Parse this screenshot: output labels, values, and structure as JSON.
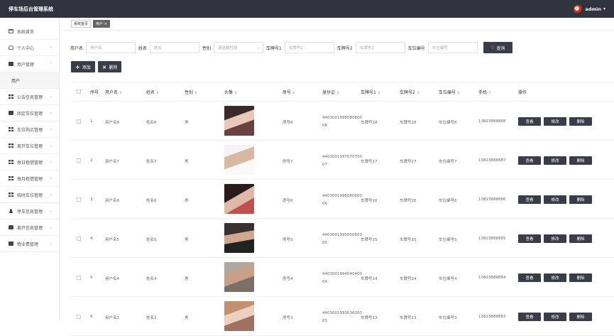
{
  "app": {
    "title": "停车场后台管理系统",
    "username": "admin"
  },
  "sidebar": {
    "items": [
      {
        "label": "系统首页",
        "icon": "home-icon",
        "chevron": ""
      },
      {
        "label": "个人中心",
        "icon": "user-icon",
        "chevron": "⌄"
      },
      {
        "label": "用户管理",
        "icon": "monitor-icon",
        "chevron": "⌃"
      },
      {
        "label": "公告信息管理",
        "icon": "grid-icon",
        "chevron": "⌄"
      },
      {
        "label": "固定车位管理",
        "icon": "message-icon",
        "chevron": "⌄"
      },
      {
        "label": "车位购买管理",
        "icon": "grid-icon",
        "chevron": "⌄"
      },
      {
        "label": "离开车位管理",
        "icon": "grid-icon",
        "chevron": "⌄"
      },
      {
        "label": "每日租借管理",
        "icon": "grid-icon",
        "chevron": "⌄"
      },
      {
        "label": "每月租借管理",
        "icon": "grid-icon",
        "chevron": "⌄"
      },
      {
        "label": "临时车位管理",
        "icon": "grid-icon",
        "chevron": "⌄"
      },
      {
        "label": "停车信息管理",
        "icon": "person-icon",
        "chevron": "⌄"
      },
      {
        "label": "离开信息管理",
        "icon": "car-icon",
        "chevron": "⌄"
      },
      {
        "label": "物业费管理",
        "icon": "trash-icon",
        "chevron": "⌄"
      }
    ],
    "sub_item": "用户"
  },
  "tabs": [
    {
      "label": "系统首页"
    },
    {
      "label": "用户 ×"
    }
  ],
  "search": {
    "username_label": "用户名",
    "username_placeholder": "用户名",
    "name_label": "姓名",
    "name_placeholder": "姓名",
    "gender_label": "性别",
    "gender_placeholder": "请选择性别",
    "plate1_label": "车牌号1",
    "plate1_placeholder": "车牌号1",
    "plate2_label": "车牌号2",
    "plate2_placeholder": "车牌号2",
    "spot_label": "车位编号",
    "spot_placeholder": "车位编号",
    "button_label": "查询"
  },
  "actions": {
    "add_label": "添加",
    "delete_label": "删除"
  },
  "table": {
    "headers": [
      "序号",
      "用户名",
      "姓名",
      "性别",
      "头像",
      "房号",
      "身份证",
      "车牌号1",
      "车牌号2",
      "车位编号",
      "手机",
      "操作"
    ],
    "rows": [
      {
        "no": "1",
        "username": "用户名8",
        "name": "姓名8",
        "gender": "男",
        "room": "房号8",
        "id1": "4403001998080800",
        "id2": "08",
        "plate1": "车牌号18",
        "plate2": "车牌号28",
        "spot": "车位编号8",
        "phone": "13823888888"
      },
      {
        "no": "2",
        "username": "用户名7",
        "name": "姓名7",
        "gender": "男",
        "room": "房号7",
        "id1": "4403001997070700",
        "id2": "07",
        "plate1": "车牌号17",
        "plate2": "车牌号27",
        "spot": "车位编号7",
        "phone": "13823888887"
      },
      {
        "no": "3",
        "username": "用户名6",
        "name": "姓名6",
        "gender": "男",
        "room": "房号6",
        "id1": "4403001996060600",
        "id2": "06",
        "plate1": "车牌号16",
        "plate2": "车牌号26",
        "spot": "车位编号6",
        "phone": "13823888886"
      },
      {
        "no": "4",
        "username": "用户名5",
        "name": "姓名5",
        "gender": "男",
        "room": "房号5",
        "id1": "4403001995050500",
        "id2": "05",
        "plate1": "车牌号15",
        "plate2": "车牌号25",
        "spot": "车位编号5",
        "phone": "13823888885"
      },
      {
        "no": "5",
        "username": "用户名4",
        "name": "姓名4",
        "gender": "男",
        "room": "房号4",
        "id1": "4403001994040400",
        "id2": "04",
        "plate1": "车牌号14",
        "plate2": "车牌号24",
        "spot": "车位编号4",
        "phone": "13823888884"
      },
      {
        "no": "6",
        "username": "用户名3",
        "name": "姓名3",
        "gender": "男",
        "room": "房号3",
        "id1": "4403001993030300",
        "id2": "03",
        "plate1": "车牌号13",
        "plate2": "车牌号23",
        "spot": "车位编号3",
        "phone": "13823888883"
      }
    ],
    "row_buttons": {
      "view": "查看",
      "edit": "修改",
      "delete": "删除"
    }
  }
}
